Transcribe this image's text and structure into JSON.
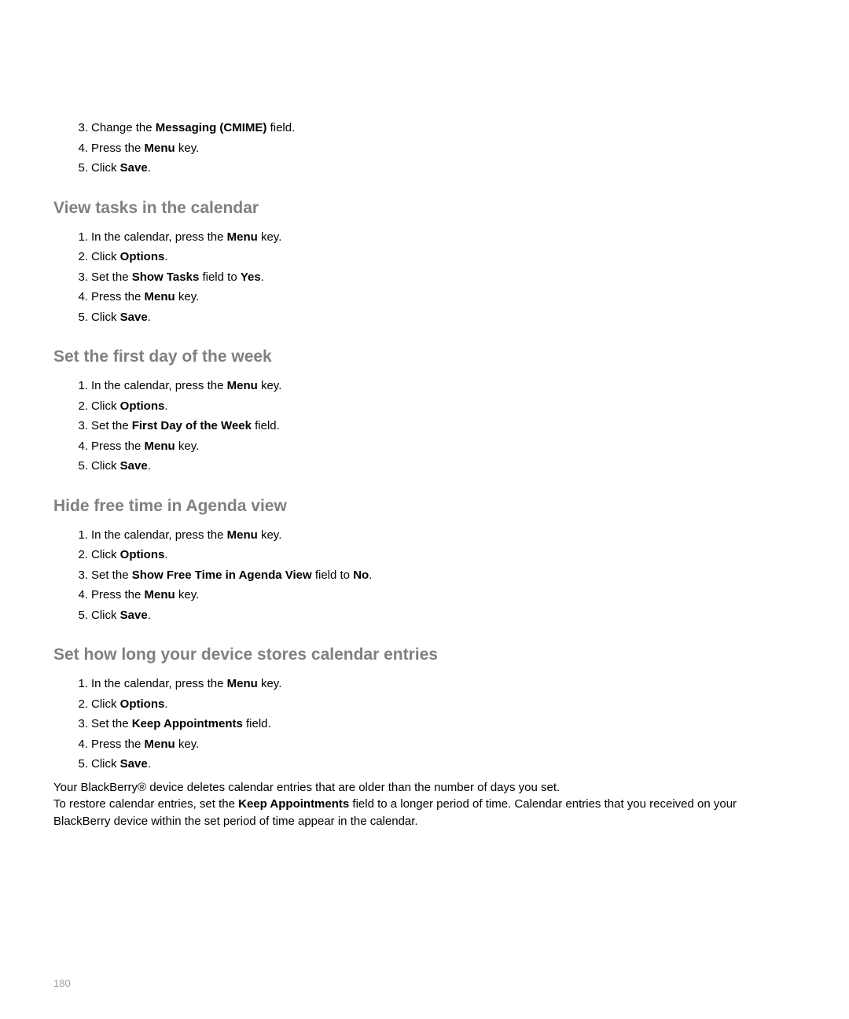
{
  "intro_steps": [
    {
      "num": "3.",
      "pre": "Change the ",
      "bold": "Messaging (CMIME)",
      "post": " field."
    },
    {
      "num": "4.",
      "pre": "Press the ",
      "bold": "Menu",
      "post": " key."
    },
    {
      "num": "5.",
      "pre": "Click ",
      "bold": "Save",
      "post": "."
    }
  ],
  "section1": {
    "heading": "View tasks in the calendar",
    "steps": [
      {
        "num": "1.",
        "pre": "In the calendar, press the ",
        "bold": "Menu",
        "post": " key."
      },
      {
        "num": "2.",
        "pre": "Click ",
        "bold": "Options",
        "post": "."
      },
      {
        "num": "3.",
        "pre": "Set the ",
        "bold": "Show Tasks",
        "post": " field to ",
        "bold2": "Yes",
        "post2": "."
      },
      {
        "num": "4.",
        "pre": "Press the ",
        "bold": "Menu",
        "post": " key."
      },
      {
        "num": "5.",
        "pre": "Click ",
        "bold": "Save",
        "post": "."
      }
    ]
  },
  "section2": {
    "heading": "Set the first day of the week",
    "steps": [
      {
        "num": "1.",
        "pre": "In the calendar, press the ",
        "bold": "Menu",
        "post": " key."
      },
      {
        "num": "2.",
        "pre": "Click ",
        "bold": "Options",
        "post": "."
      },
      {
        "num": "3.",
        "pre": "Set the ",
        "bold": "First Day of the Week",
        "post": " field."
      },
      {
        "num": "4.",
        "pre": "Press the ",
        "bold": "Menu",
        "post": " key."
      },
      {
        "num": "5.",
        "pre": "Click ",
        "bold": "Save",
        "post": "."
      }
    ]
  },
  "section3": {
    "heading": "Hide free time in Agenda view",
    "steps": [
      {
        "num": "1.",
        "pre": "In the calendar, press the ",
        "bold": "Menu",
        "post": " key."
      },
      {
        "num": "2.",
        "pre": "Click ",
        "bold": "Options",
        "post": "."
      },
      {
        "num": "3.",
        "pre": "Set the ",
        "bold": "Show Free Time in Agenda View",
        "post": " field to ",
        "bold2": "No",
        "post2": "."
      },
      {
        "num": "4.",
        "pre": "Press the ",
        "bold": "Menu",
        "post": " key."
      },
      {
        "num": "5.",
        "pre": "Click ",
        "bold": "Save",
        "post": "."
      }
    ]
  },
  "section4": {
    "heading": "Set how long your device stores calendar entries",
    "steps": [
      {
        "num": "1.",
        "pre": "In the calendar, press the ",
        "bold": "Menu",
        "post": " key."
      },
      {
        "num": "2.",
        "pre": "Click ",
        "bold": "Options",
        "post": "."
      },
      {
        "num": "3.",
        "pre": "Set the ",
        "bold": "Keep Appointments",
        "post": " field."
      },
      {
        "num": "4.",
        "pre": "Press the ",
        "bold": "Menu",
        "post": " key."
      },
      {
        "num": "5.",
        "pre": "Click ",
        "bold": "Save",
        "post": "."
      }
    ],
    "para1": "Your BlackBerry® device deletes calendar entries that are older than the number of days you set.",
    "para2_pre": "To restore calendar entries, set the ",
    "para2_bold": "Keep Appointments",
    "para2_post": " field to a longer period of time. Calendar entries that you received on your BlackBerry device within the set period of time appear in the calendar."
  },
  "page_number": "180"
}
